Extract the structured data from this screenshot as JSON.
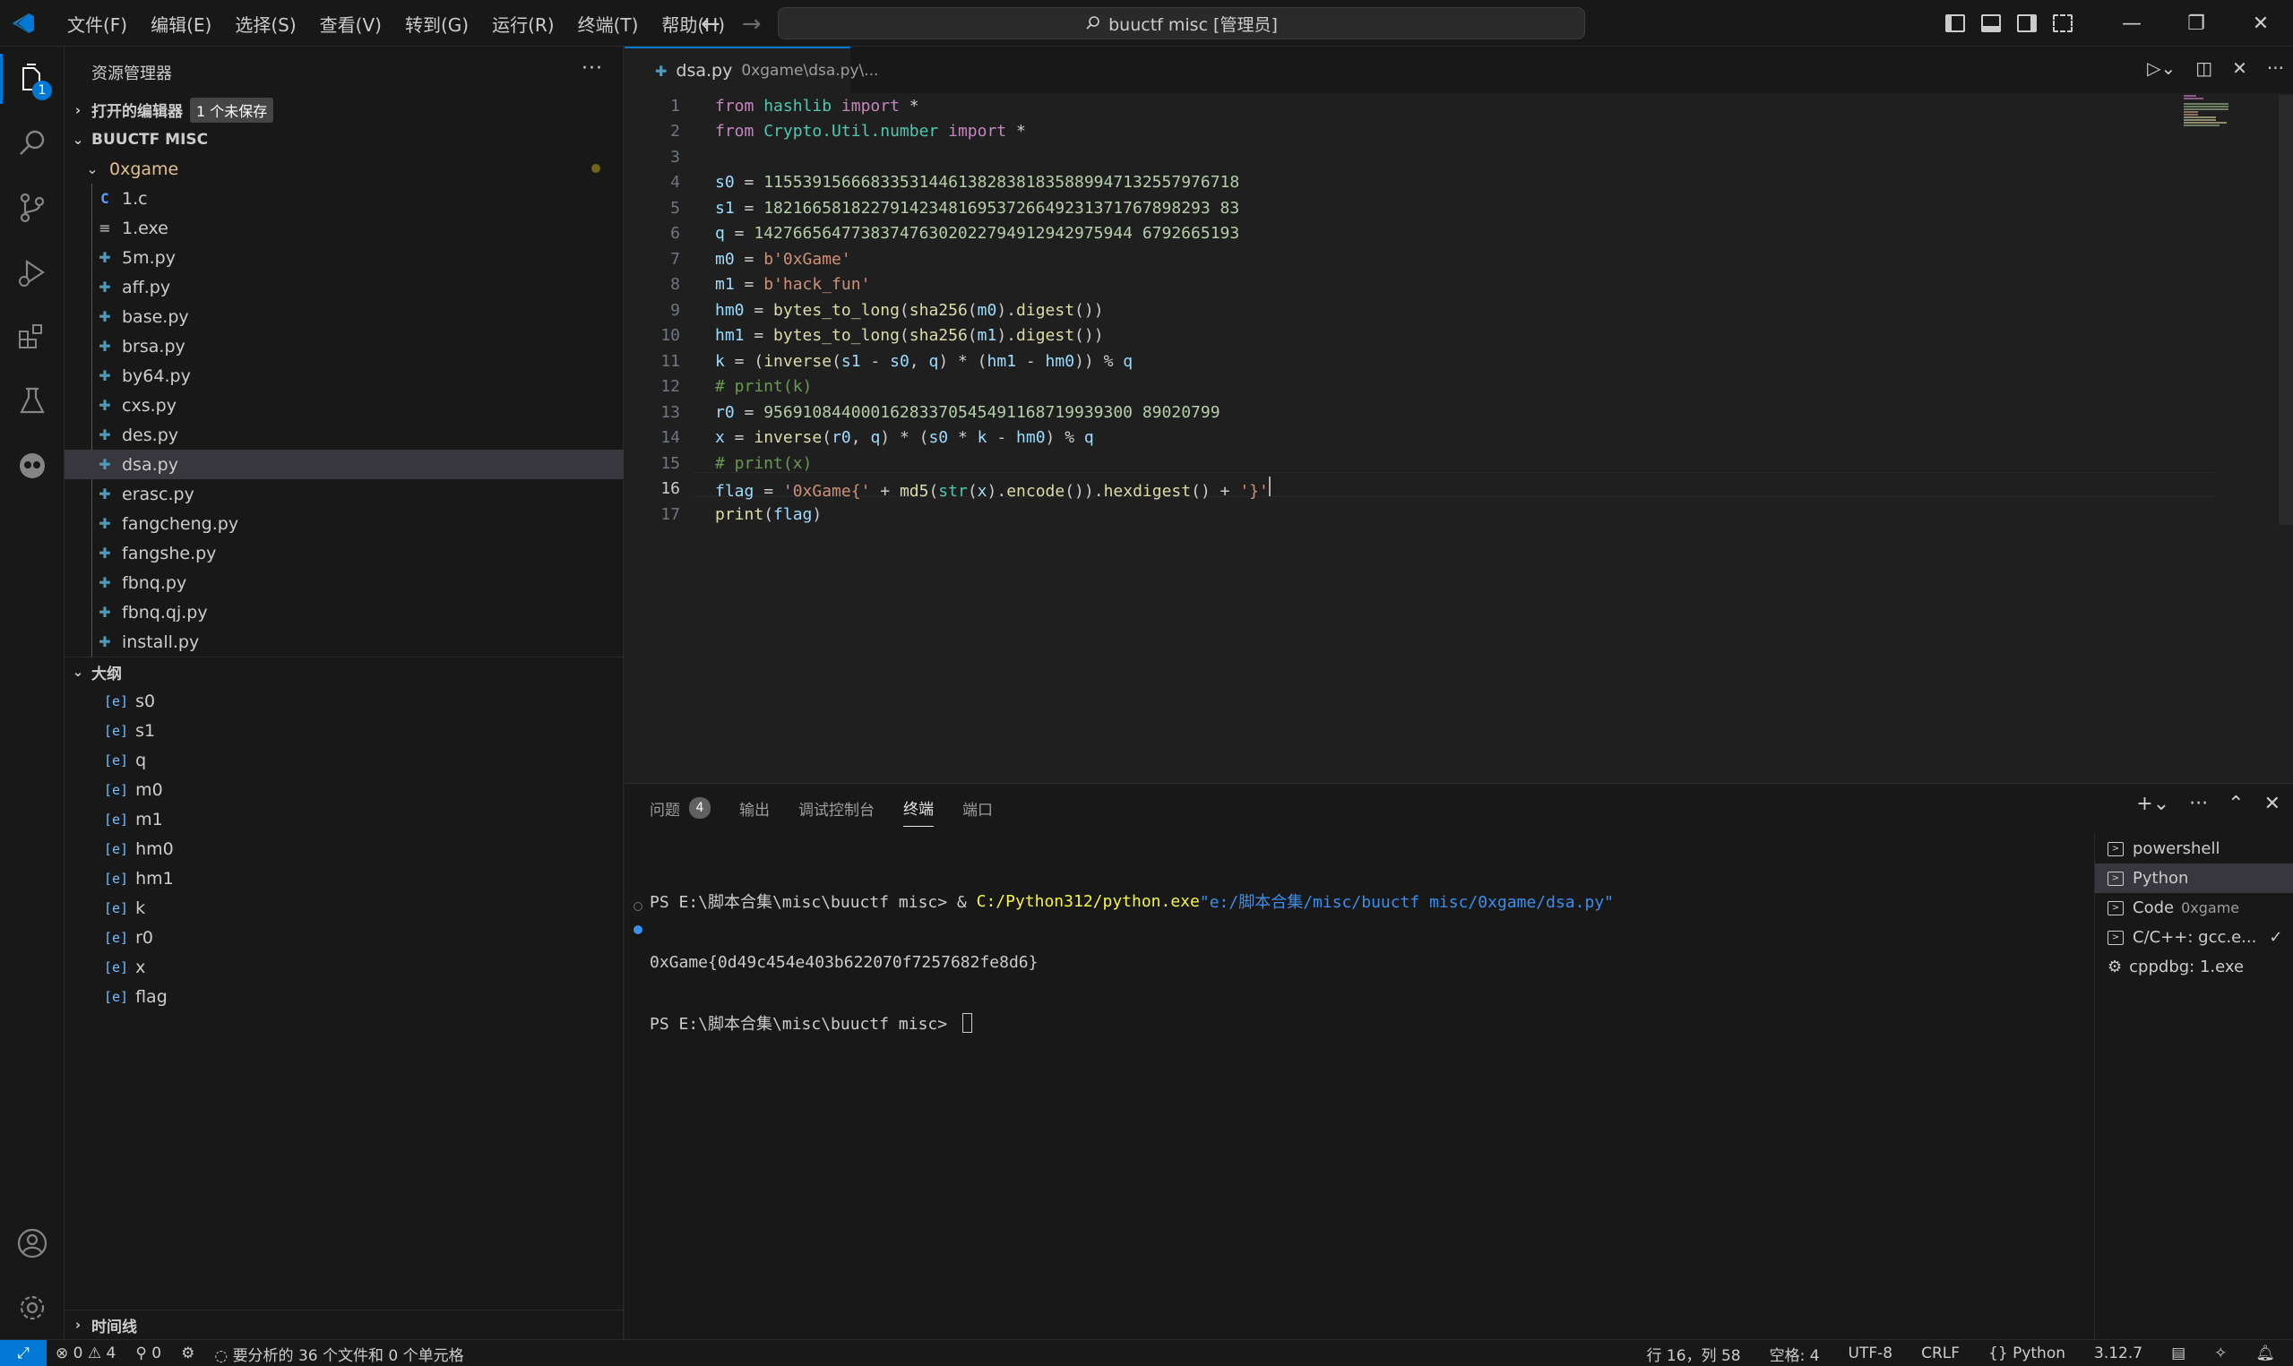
{
  "titlebar": {
    "menus": [
      "文件(F)",
      "编辑(E)",
      "选择(S)",
      "查看(V)",
      "转到(G)",
      "运行(R)",
      "终端(T)",
      "帮助(H)"
    ],
    "search": "buuctf misc [管理员]"
  },
  "activity": {
    "explorer_badge": "1"
  },
  "sidebar": {
    "title": "资源管理器",
    "open_editors": {
      "label": "打开的编辑器",
      "badge": "1 个未保存"
    },
    "workspace": "BUUCTF MISC",
    "folder": "0xgame",
    "files": [
      "1.c",
      "1.exe",
      "5m.py",
      "aff.py",
      "base.py",
      "brsa.py",
      "by64.py",
      "cxs.py",
      "des.py",
      "dsa.py",
      "erasc.py",
      "fangcheng.py",
      "fangshe.py",
      "fbnq.py",
      "fbnq.qj.py",
      "install.py"
    ],
    "outline": {
      "label": "大纲",
      "symbols": [
        "s0",
        "s1",
        "q",
        "m0",
        "m1",
        "hm0",
        "hm1",
        "k",
        "r0",
        "x",
        "flag"
      ]
    },
    "timeline": "时间线"
  },
  "editor": {
    "tab": {
      "name": "dsa.py",
      "path": "0xgame\\dsa.py\\..."
    },
    "line_numbers": [
      "1",
      "2",
      "3",
      "4",
      "5",
      "6",
      "7",
      "8",
      "9",
      "10",
      "11",
      "12",
      "13",
      "14",
      "15",
      "16",
      "17"
    ],
    "code": {
      "l1_kw1": "from",
      "l1_mod": "hashlib",
      "l1_kw2": "import",
      "l1_rest": " *",
      "l2_kw1": "from",
      "l2_mod": "Crypto.Util.number",
      "l2_kw2": "import",
      "l2_rest": " *",
      "l4_var": "s0",
      "l4_num": "1155391566683353144613828381835889947132557976718",
      "l5_var": "s1",
      "l5_num": "1821665818227914234816953726649231371767898293 83",
      "l6_var": "q",
      "l6_num": "142766564773837476302022794912942975944 6792665193",
      "l7_var": "m0",
      "l7_str": "b'0xGame'",
      "l8_var": "m1",
      "l8_str": "b'hack_fun'",
      "l9_var": "hm0",
      "l10_var": "hm1",
      "fn_b2l": "bytes_to_long",
      "fn_sha": "sha256",
      "fn_digest": "digest",
      "l11_var": "k",
      "fn_inverse": "inverse",
      "l12_cm": "# print(k)",
      "l13_var": "r0",
      "l13_num": "95691084400016283370545491168719939300 89020799",
      "l14_var": "x",
      "l15_cm": "# print(x)",
      "l16_var": "flag",
      "l16_str1": "'0xGame{'",
      "fn_md5": "md5",
      "fn_str": "str",
      "fn_encode": "encode",
      "fn_hexdigest": "hexdigest",
      "l16_str2": "'}'",
      "l17_fn": "print",
      "l17_arg": "flag"
    }
  },
  "panel": {
    "tabs": [
      "问题",
      "输出",
      "调试控制台",
      "终端",
      "端口"
    ],
    "problems_count": "4",
    "terminal": {
      "prompt1": "PS E:\\脚本合集\\misc\\buuctf misc> & ",
      "exe": "C:/Python312/python.exe",
      "script": "\"e:/脚本合集/misc/buuctf misc/0xgame/dsa.py\"",
      "output": "0xGame{0d49c454e403b622070f7257682fe8d6}",
      "prompt2": "PS E:\\脚本合集\\misc\\buuctf misc> "
    },
    "terminals": [
      {
        "name": "powershell",
        "sub": ""
      },
      {
        "name": "Python",
        "sub": ""
      },
      {
        "name": "Code",
        "sub": "0xgame"
      },
      {
        "name": "C/C++: gcc.e...",
        "sub": ""
      },
      {
        "name": "cppdbg: 1.exe",
        "sub": ""
      }
    ]
  },
  "statusbar": {
    "errors": "0",
    "warnings": "4",
    "ports": "0",
    "analysis": "要分析的 36 个文件和 0 个单元格",
    "position": "行 16，列 58",
    "spaces": "空格: 4",
    "encoding": "UTF-8",
    "eol": "CRLF",
    "language": "Python",
    "version": "3.12.7"
  }
}
